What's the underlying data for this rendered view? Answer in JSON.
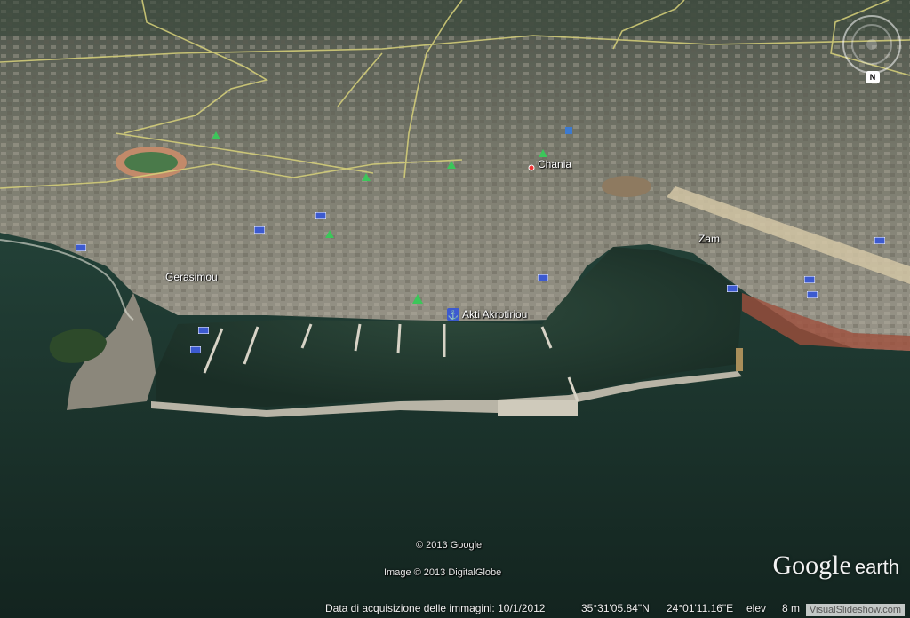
{
  "map": {
    "type": "satellite-3d",
    "place_labels": [
      {
        "name": "Chania"
      },
      {
        "name": "Gerasimou"
      },
      {
        "name": "Zam"
      },
      {
        "name": "Akti Akrotiriou"
      }
    ],
    "credits": {
      "copyright": "© 2013 Google",
      "imagery": "Image © 2013 DigitalGlobe"
    }
  },
  "status_bar": {
    "acquisition_date": "Data di acquisizione delle immagini: 10/1/2012",
    "latitude": "35°31'05.84\"N",
    "longitude": "24°01'11.16\"E",
    "elevation_label": "elev",
    "elevation_value": "8 m"
  },
  "branding": {
    "logo_main": "Google",
    "logo_sub": "earth",
    "watermark": "VisualSlideshow.com"
  },
  "navigation": {
    "north_label": "N"
  },
  "colors": {
    "sea": "#1f3a32",
    "city": "#8a8a7a",
    "roads": "#d8d27a",
    "icon_park": "#3cc65a",
    "icon_hotel": "#3c5ad0"
  }
}
